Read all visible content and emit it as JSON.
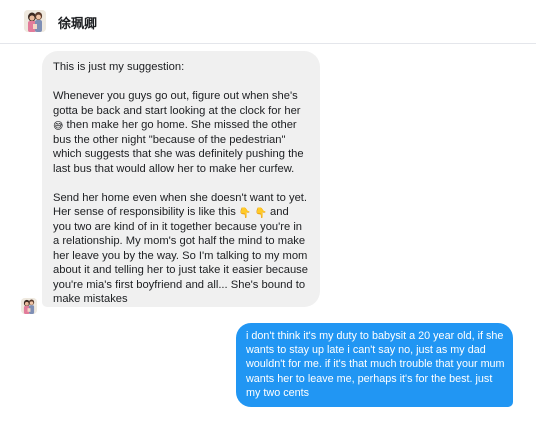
{
  "header": {
    "contact_name": "徐珮卿",
    "avatar_icon": "profile-photo"
  },
  "conversation": {
    "incoming": {
      "avatar_icon": "profile-photo",
      "paragraph_1": "This is just my suggestion:",
      "paragraph_2_a": "Whenever you guys go out, figure out when she's gotta be back and start looking at the clock for her ",
      "paragraph_2_emoji": "😅",
      "paragraph_2_b": " then make her go home. She missed the other bus the other night \"because of the pedestrian\" which suggests that she was definitely pushing the last bus that would allow her to make her curfew.",
      "paragraph_3_a": "Send her home even when she doesn't want to yet. Her sense of responsibility is like this ",
      "paragraph_3_emoji_1": "👇",
      "paragraph_3_emoji_2": "👇",
      "paragraph_3_b": " and you two are kind of in it together because you're in a relationship. My mom's got half the mind to make her leave you by the way. So I'm talking to my mom about it and telling her to just take it easier because you're mia's first boyfriend and all... She's bound to make mistakes"
    },
    "outgoing": {
      "text": "i don't think it's my duty to babysit a 20 year old, if she wants to stay up late i can't say no, just as my dad wouldn't for me. if it's that much trouble that your mum wants her to leave me, perhaps it's for the best. just my two cents"
    }
  },
  "colors": {
    "incoming_bubble": "#f0f0f0",
    "outgoing_bubble": "#2196f3",
    "outgoing_text": "#ffffff"
  }
}
